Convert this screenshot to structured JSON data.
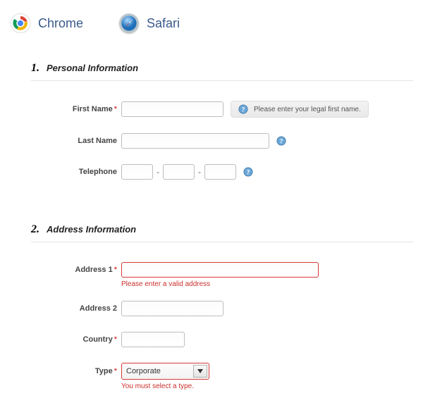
{
  "browsers": {
    "chrome": "Chrome",
    "safari": "Safari"
  },
  "sections": {
    "personal": {
      "number": "1.",
      "title": "Personal Information"
    },
    "address": {
      "number": "2.",
      "title": "Address Information"
    }
  },
  "labels": {
    "first_name": "First Name",
    "last_name": "Last Name",
    "telephone": "Telephone",
    "address1": "Address 1",
    "address2": "Address 2",
    "country": "Country",
    "type": "Type"
  },
  "tooltips": {
    "first_name": "Please enter your legal first name."
  },
  "errors": {
    "address1": "Please enter a valid address",
    "type": "You must select a type."
  },
  "values": {
    "type_selected": "Corporate"
  },
  "asterisk": "*",
  "dash": "-"
}
